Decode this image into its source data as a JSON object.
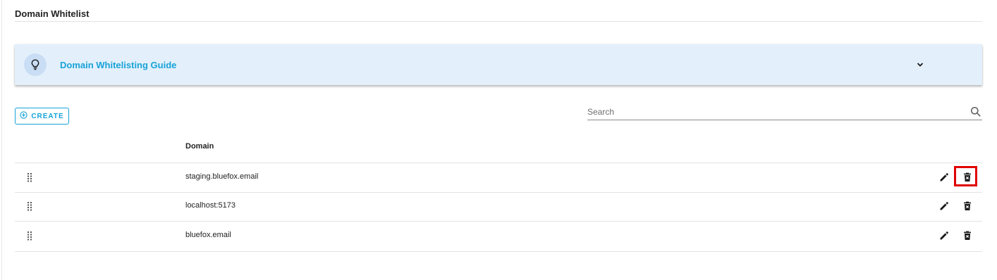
{
  "page": {
    "title": "Domain Whitelist"
  },
  "guide": {
    "title": "Domain Whitelisting Guide",
    "icon": "lightbulb-icon",
    "toggle_icon": "chevron-down-icon"
  },
  "toolbar": {
    "create_label": "CREATE",
    "create_icon": "add-circle-outline-icon",
    "search_placeholder": "Search",
    "search_value": "",
    "search_icon": "search-icon"
  },
  "table": {
    "columns": [
      "Domain"
    ],
    "rows": [
      {
        "domain": "staging.bluefox.email",
        "delete_highlighted": true
      },
      {
        "domain": "localhost:5173",
        "delete_highlighted": false
      },
      {
        "domain": "bluefox.email",
        "delete_highlighted": false
      }
    ],
    "row_actions": [
      "edit-icon",
      "delete-icon"
    ]
  },
  "colors": {
    "accent": "#17a2d8",
    "guide_background": "#e3f0fb",
    "highlight": "#e00000"
  }
}
